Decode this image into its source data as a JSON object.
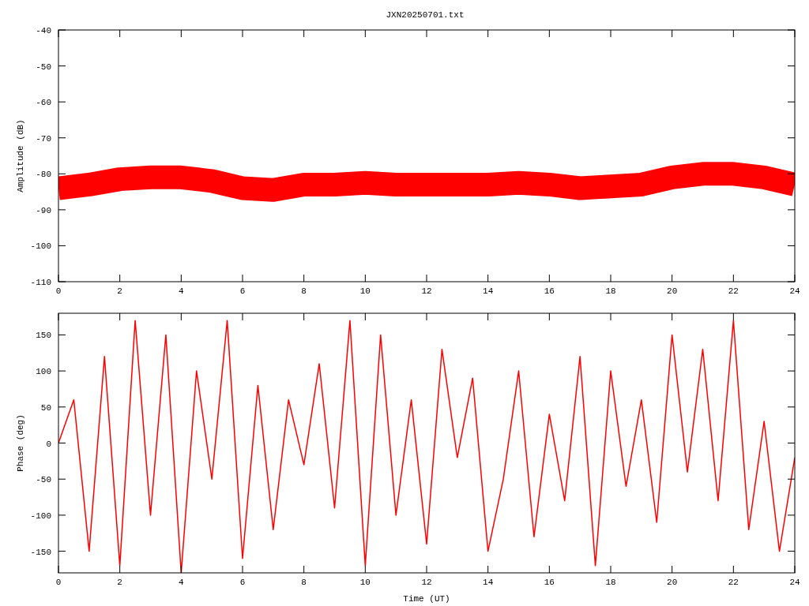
{
  "title": "JXN20250701.txt",
  "charts": [
    {
      "chart_data": {
        "type": "line",
        "ylabel": "Amplitude (dB)",
        "xlim": [
          0,
          24
        ],
        "ylim": [
          -110,
          -40
        ],
        "xticks": [
          0,
          2,
          4,
          6,
          8,
          10,
          12,
          14,
          16,
          18,
          20,
          22,
          24
        ],
        "yticks": [
          -110,
          -100,
          -90,
          -80,
          -70,
          -60,
          -50,
          -40
        ],
        "x": [
          0,
          1,
          2,
          3,
          4,
          5,
          6,
          7,
          8,
          9,
          10,
          11,
          12,
          13,
          14,
          15,
          16,
          17,
          18,
          19,
          20,
          21,
          22,
          23,
          24
        ],
        "series": [
          {
            "color": "#ff0000",
            "values": [
              -84,
              -83,
              -81.5,
              -81,
              -81,
              -82,
              -84,
              -84.5,
              -83,
              -83,
              -82.5,
              -83,
              -83,
              -83,
              -83,
              -82.5,
              -83,
              -84,
              -83.5,
              -83,
              -81,
              -80,
              -80,
              -81,
              -83
            ]
          }
        ]
      }
    },
    {
      "chart_data": {
        "type": "line",
        "xlabel": "Time (UT)",
        "ylabel": "Phase (deg)",
        "xlim": [
          0,
          24
        ],
        "ylim": [
          -180,
          180
        ],
        "xticks": [
          0,
          2,
          4,
          6,
          8,
          10,
          12,
          14,
          16,
          18,
          20,
          22,
          24
        ],
        "yticks": [
          -150,
          -100,
          -50,
          0,
          50,
          100,
          150
        ],
        "x": [
          0,
          0.5,
          1,
          1.5,
          2,
          2.5,
          3,
          3.5,
          4,
          4.5,
          5,
          5.5,
          6,
          6.5,
          7,
          7.5,
          8,
          8.5,
          9,
          9.5,
          10,
          10.5,
          11,
          11.5,
          12,
          12.5,
          13,
          13.5,
          14,
          14.5,
          15,
          15.5,
          16,
          16.5,
          17,
          17.5,
          18,
          18.5,
          19,
          19.5,
          20,
          20.5,
          21,
          21.5,
          22,
          22.5,
          23,
          23.5,
          24
        ],
        "series": [
          {
            "color": "#ff0000",
            "values": [
              0,
              60,
              -150,
              120,
              -170,
              170,
              -100,
              150,
              -180,
              100,
              -50,
              170,
              -160,
              80,
              -120,
              60,
              -30,
              110,
              -90,
              170,
              -170,
              150,
              -100,
              60,
              -140,
              130,
              -20,
              90,
              -150,
              -50,
              100,
              -130,
              40,
              -80,
              120,
              -170,
              100,
              -60,
              60,
              -110,
              150,
              -40,
              130,
              -80,
              170,
              -120,
              30,
              -150,
              -20
            ]
          }
        ]
      }
    }
  ]
}
